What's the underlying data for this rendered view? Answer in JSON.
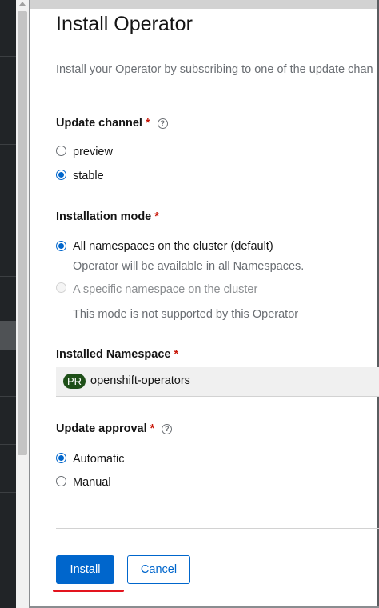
{
  "page": {
    "title": "Install Operator",
    "description": "Install your Operator by subscribing to one of the update chan"
  },
  "update_channel": {
    "label": "Update channel",
    "required_mark": "*",
    "help_icon": "question-circle-icon",
    "options": [
      {
        "label": "preview",
        "checked": false
      },
      {
        "label": "stable",
        "checked": true
      }
    ]
  },
  "installation_mode": {
    "label": "Installation mode",
    "required_mark": "*",
    "options": [
      {
        "label": "All namespaces on the cluster (default)",
        "description": "Operator will be available in all Namespaces.",
        "checked": true,
        "disabled": false
      },
      {
        "label": "A specific namespace on the cluster",
        "description": "This mode is not supported by this Operator",
        "checked": false,
        "disabled": true
      }
    ]
  },
  "installed_namespace": {
    "label": "Installed Namespace",
    "required_mark": "*",
    "badge": "PR",
    "value": "openshift-operators"
  },
  "update_approval": {
    "label": "Update approval",
    "required_mark": "*",
    "help_icon": "question-circle-icon",
    "options": [
      {
        "label": "Automatic",
        "checked": true
      },
      {
        "label": "Manual",
        "checked": false
      }
    ]
  },
  "actions": {
    "install_label": "Install",
    "cancel_label": "Cancel"
  },
  "colors": {
    "primary": "#0066cc",
    "required": "#c9190b",
    "badge_bg": "#1e4f18",
    "annotation": "#e3141e"
  }
}
